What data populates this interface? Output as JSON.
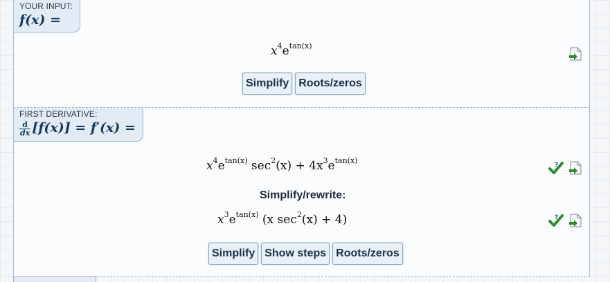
{
  "input": {
    "tab_label": "YOUR INPUT:",
    "tab_formula": "f(x) =",
    "expression_base": "x",
    "expression_base_power": "4",
    "expression_e": "e",
    "expression_e_power": "tan(x)",
    "buttons": [
      "Simplify",
      "Roots/zeros"
    ]
  },
  "derivative": {
    "tab_label": "FIRST DERIVATIVE:",
    "tab_formula": "[f(x)] = f′(x) =",
    "tab_frac_num": "d",
    "tab_frac_den": "dx",
    "result": {
      "p1": "x",
      "p1_pow": "4",
      "p2": "e",
      "p2_pow": "tan(x)",
      "p3": " sec",
      "p3_pow": "2",
      "p4": "(x) + 4x",
      "p4_pow": "3",
      "p5": "e",
      "p5_pow": "tan(x)"
    },
    "rewrite_label": "Simplify/rewrite:",
    "simplified": {
      "p1": "x",
      "p1_pow": "3",
      "p2": "e",
      "p2_pow": "tan(x)",
      "p3": "(x sec",
      "p3_pow": "2",
      "p4": "(x) + 4)"
    },
    "buttons": [
      "Simplify",
      "Show steps",
      "Roots/zeros"
    ]
  },
  "colors": {
    "check": "#2e8b2e",
    "page_icon": "#7a8a96",
    "accent": "#14385a"
  },
  "icons": [
    "export-page-icon",
    "check-mark-icon"
  ]
}
